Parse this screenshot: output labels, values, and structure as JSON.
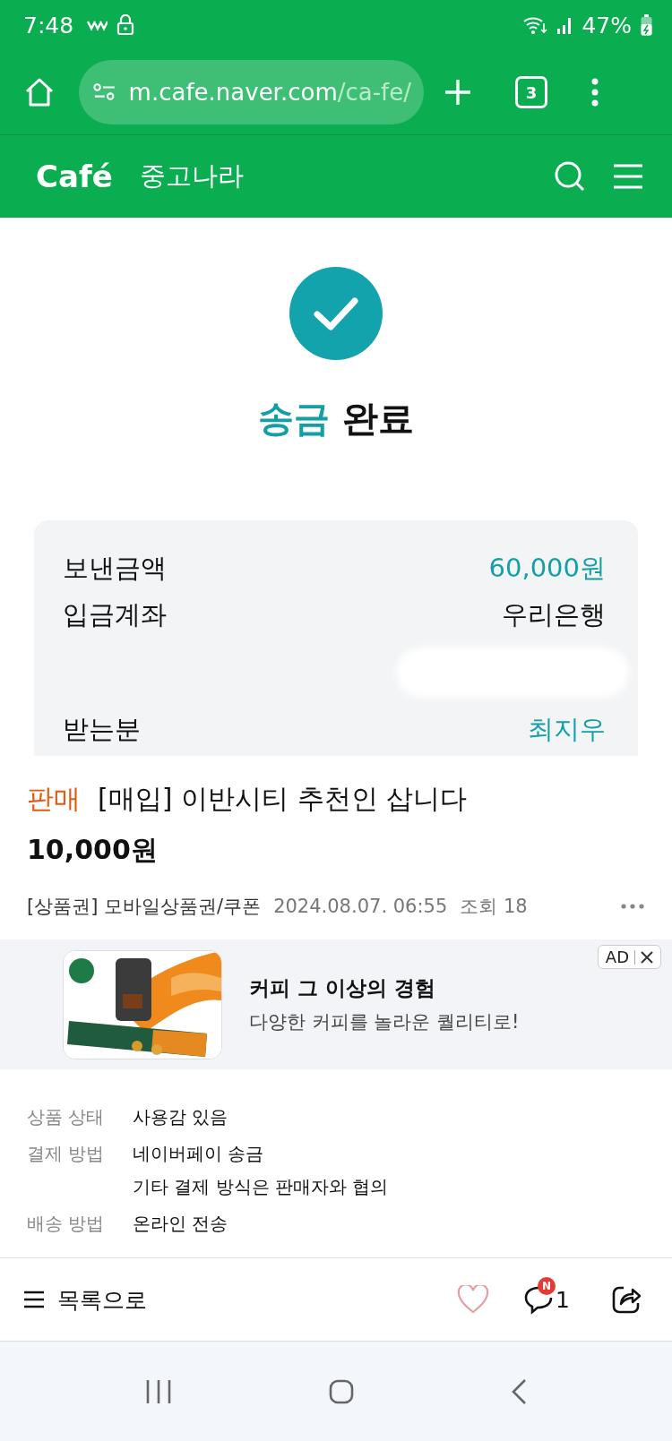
{
  "status_bar": {
    "time": "7:48",
    "battery": "47%"
  },
  "browser": {
    "url_host": "m.cafe.naver.com",
    "url_path": "/ca-fe/",
    "tab_count": "3"
  },
  "cafe_header": {
    "logo": "Café",
    "cafe_name": "중고나라"
  },
  "result": {
    "title_accent": "송금",
    "title_rest": "완료"
  },
  "transfer_rows": [
    {
      "kind": "text",
      "label": "보낸금액",
      "value": "60,000원",
      "highlight": true
    },
    {
      "kind": "text",
      "label": "입금계좌",
      "value": "우리은행",
      "highlight": false
    },
    {
      "kind": "hidden"
    },
    {
      "kind": "text",
      "label": "받는분",
      "value": "최지우",
      "highlight": true
    }
  ],
  "post": {
    "tag": "판매",
    "title": "[매입] 이반시티 추천인 삽니다",
    "price": "10,000원",
    "category": "[상품권] 모바일상품권/쿠폰",
    "date": "2024.08.07. 06:55",
    "views": "조회 18"
  },
  "ad": {
    "kind": "picture",
    "headline": "커피 그 이상의 경험",
    "subline": "다양한 커피를 놀라운 퀄리티로!",
    "badge": "AD"
  },
  "details": [
    {
      "label": "상품 상태",
      "lines": [
        "사용감 있음"
      ]
    },
    {
      "label": "결제 방법",
      "lines": [
        "네이버페이 송금",
        "기타 결제 방식은 판매자와 협의"
      ]
    },
    {
      "label": "배송 방법",
      "lines": [
        "온라인 전송"
      ]
    }
  ],
  "bottom_bar": {
    "list_label": "목록으로",
    "liked": false,
    "comment_badge": "N",
    "comment_count": "1"
  }
}
